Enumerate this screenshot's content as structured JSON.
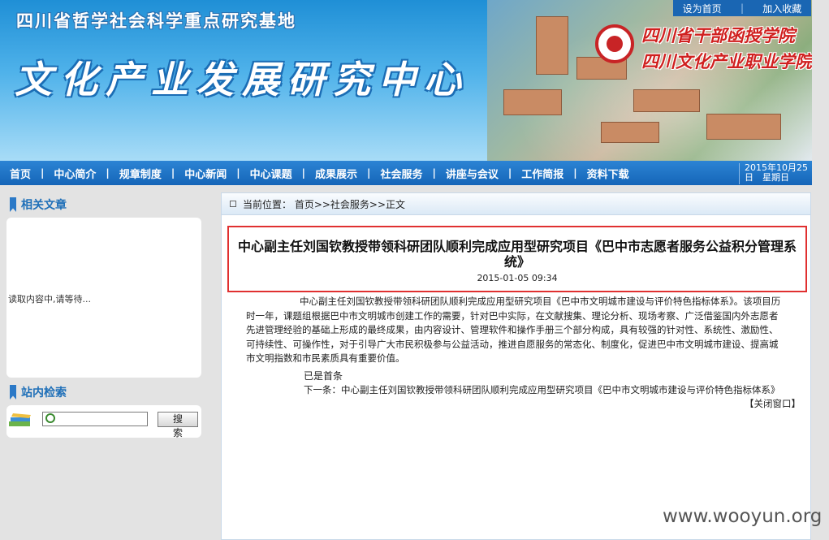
{
  "banner": {
    "subtitle": "四川省哲学社会科学重点研究基地",
    "title": "文化产业发展研究中心",
    "school1": "四川省干部函授学院",
    "school2": "四川文化产业职业学院"
  },
  "toplinks": {
    "home": "设为首页",
    "favorite": "加入收藏"
  },
  "nav": {
    "items": [
      "首页",
      "中心简介",
      "规章制度",
      "中心新闻",
      "中心课题",
      "成果展示",
      "社会服务",
      "讲座与会议",
      "工作简报",
      "资料下载"
    ],
    "date": "2015年10月25日　星期日"
  },
  "sidebar": {
    "related_title": "相关文章",
    "loading": "读取内容中,请等待...",
    "search_title": "站内检索",
    "search_button": "搜 索",
    "search_value": ""
  },
  "article": {
    "breadcrumb": "当前位置：  首页>>社会服务>>正文",
    "title": "中心副主任刘国钦教授带领科研团队顺利完成应用型研究项目《巴中市志愿者服务公益积分管理系统》",
    "time": "2015-01-05 09:34",
    "body": "中心副主任刘国钦教授带领科研团队顺利完成应用型研究项目《巴中市文明城市建设与评价特色指标体系》。该项目历时一年，课题组根据巴中市文明城市创建工作的需要，针对巴中实际，在文献搜集、理论分析、现场考察、广泛借鉴国内外志愿者先进管理经验的基础上形成的最终成果，由内容设计、管理软件和操作手册三个部分构成，具有较强的针对性、系统性、激励性、可持续性、可操作性，对于引导广大市民积极参与公益活动，推进自愿服务的常态化、制度化，促进巴中市文明城市建设、提高城市文明指数和市民素质具有重要价值。",
    "prev": "已是首条",
    "next": "下一条：中心副主任刘国钦教授带领科研团队顺利完成应用型研究项目《巴中市文明城市建设与评价特色指标体系》",
    "close": "【关闭窗口】"
  },
  "watermark": "www.wooyun.org",
  "colors": {
    "nav": "#1565b8",
    "accent": "#1e6fb8",
    "highlight": "#e03030"
  }
}
